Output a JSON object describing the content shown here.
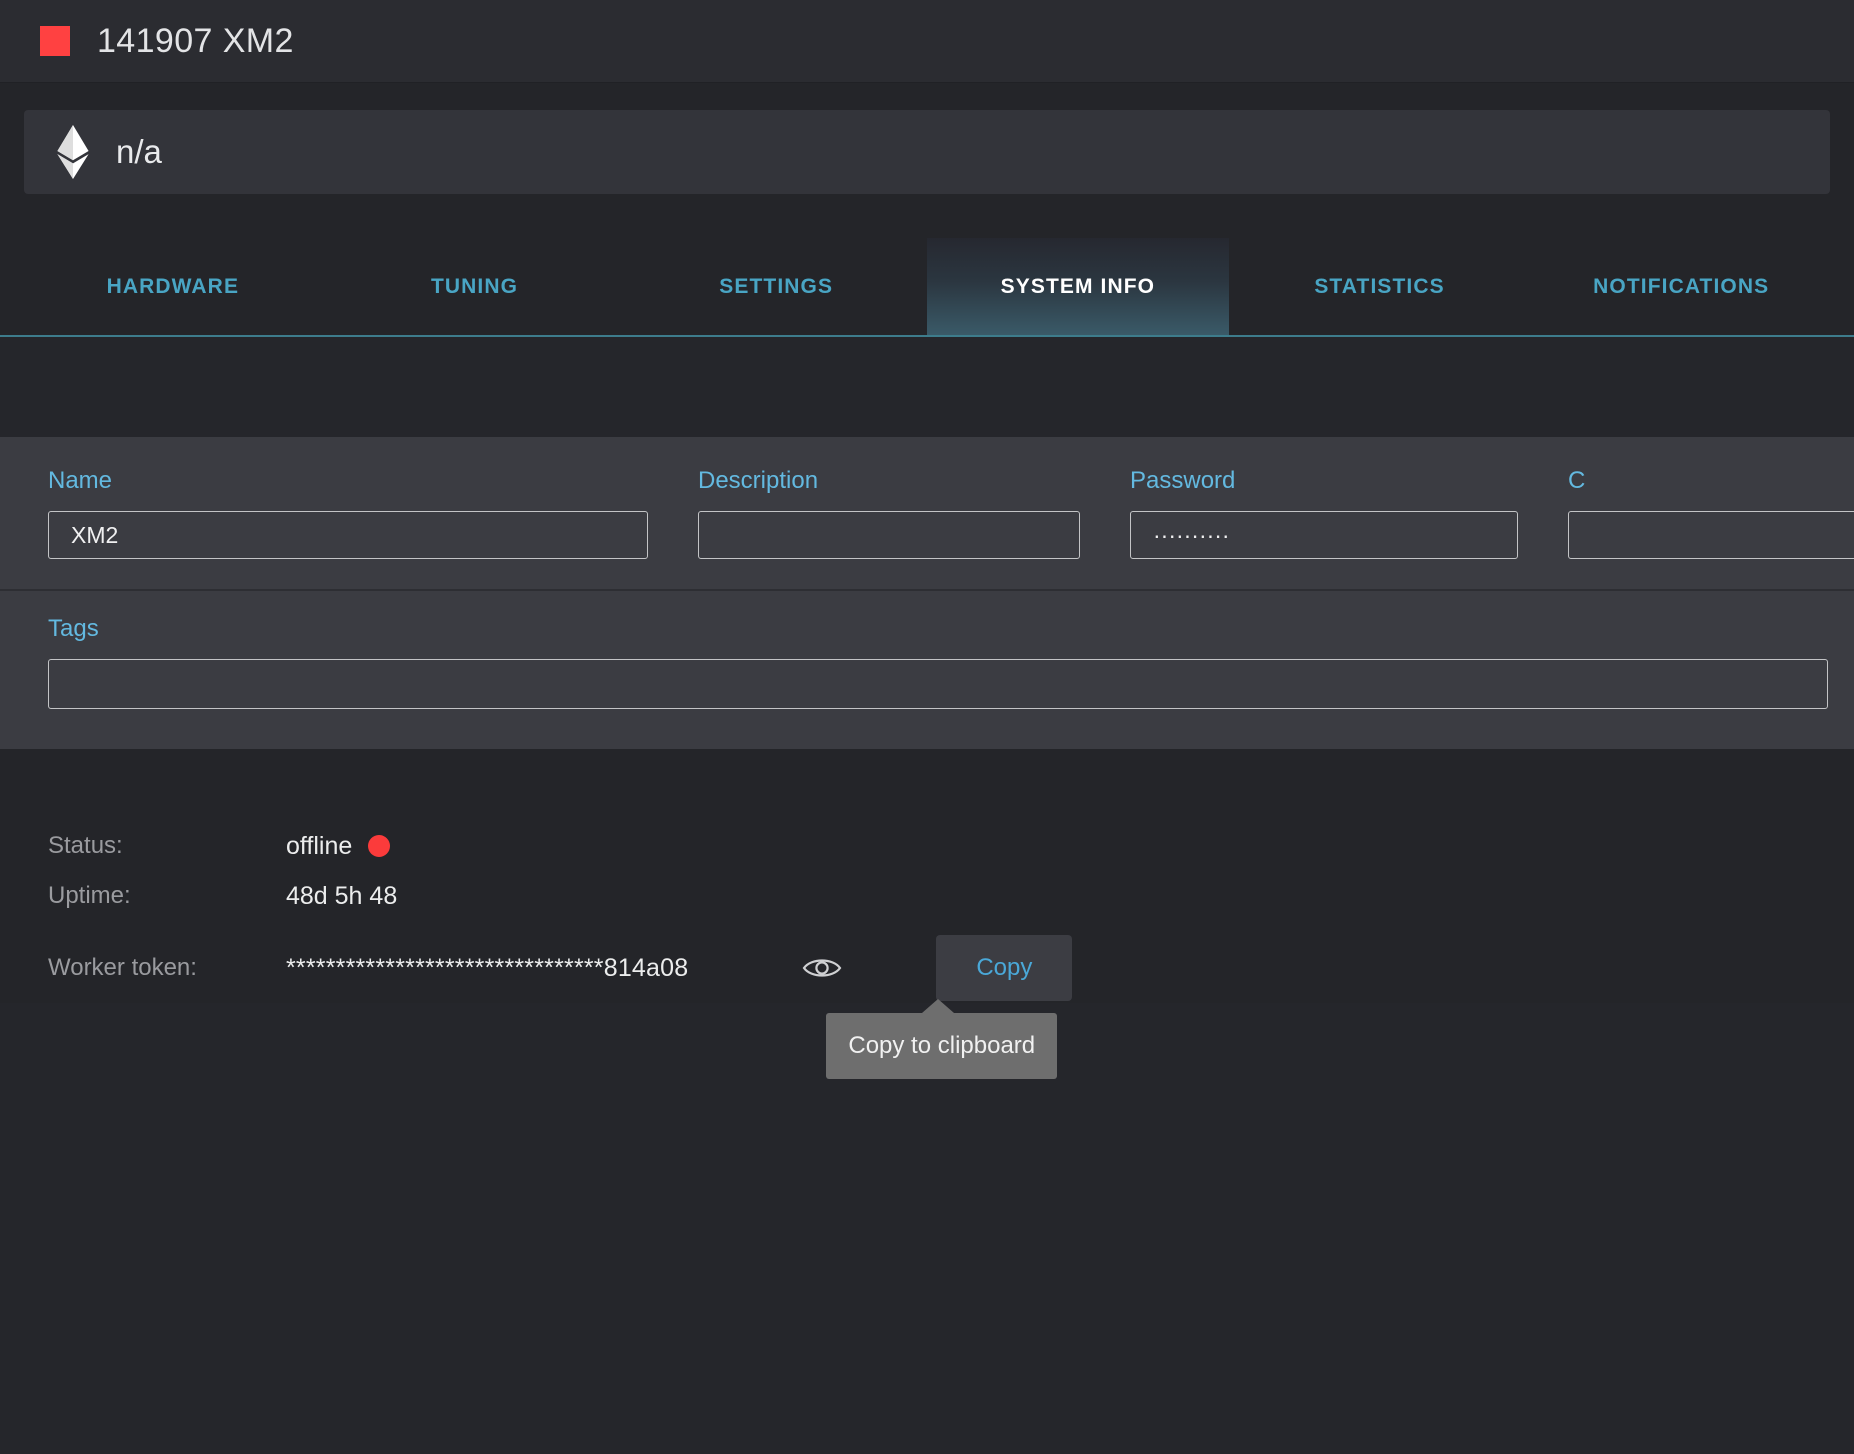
{
  "header": {
    "status_color": "#ff4141",
    "title": "141907 XM2",
    "status_square_icon": "red-square-status-icon"
  },
  "coinbar": {
    "icon": "ethereum-icon",
    "coin_label": "n/a"
  },
  "tabs": [
    {
      "label": "HARDWARE",
      "active": false
    },
    {
      "label": "TUNING",
      "active": false
    },
    {
      "label": "SETTINGS",
      "active": false
    },
    {
      "label": "SYSTEM INFO",
      "active": true
    },
    {
      "label": "STATISTICS",
      "active": false
    },
    {
      "label": "NOTIFICATIONS",
      "active": false
    }
  ],
  "form": {
    "name": {
      "label": "Name",
      "value": "XM2",
      "placeholder": ""
    },
    "description": {
      "label": "Description",
      "value": "",
      "placeholder": ""
    },
    "password": {
      "label": "Password",
      "value": "··········",
      "placeholder": ""
    },
    "extra": {
      "label": "C",
      "value": "",
      "placeholder": ""
    },
    "tags": {
      "label": "Tags",
      "value": "",
      "placeholder": ""
    }
  },
  "info": {
    "status": {
      "key": "Status:",
      "value": "offline",
      "indicator_color": "#fb3b3b"
    },
    "uptime": {
      "key": "Uptime:",
      "value": "48d 5h 48"
    },
    "worker_token": {
      "key": "Worker token:",
      "value": "********************************814a08",
      "eye_icon": "eye-icon",
      "copy_label": "Copy",
      "tooltip": "Copy to clipboard"
    }
  },
  "colors": {
    "accent_teal": "#49a5c4",
    "label_blue": "#63b9e0",
    "danger_red": "#ff4141",
    "panel_bg": "#3b3c42",
    "page_bg": "#242529"
  }
}
